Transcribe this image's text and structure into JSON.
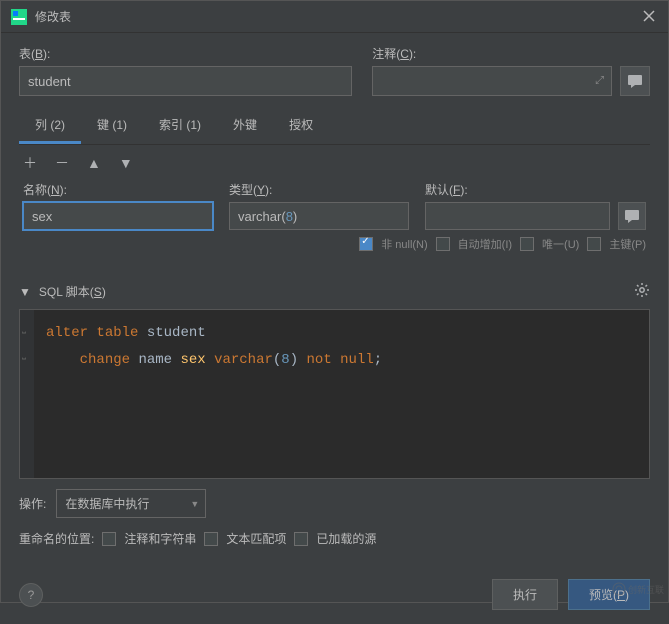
{
  "titlebar": {
    "title": "修改表"
  },
  "tableSection": {
    "tableLabelPrefix": "表(",
    "tableLabelKey": "B",
    "tableLabelSuffix": "):",
    "tableValue": "student",
    "commentLabelPrefix": "注释(",
    "commentLabelKey": "C",
    "commentLabelSuffix": "):",
    "commentValue": ""
  },
  "tabs": {
    "columns": "列 (2)",
    "keys": "键 (1)",
    "indexes": "索引 (1)",
    "foreign": "外键",
    "grants": "授权"
  },
  "fields": {
    "nameLabelPrefix": "名称(",
    "nameLabelKey": "N",
    "nameLabelSuffix": "):",
    "nameValue": "sex",
    "typeLabelPrefix": "类型(",
    "typeLabelKey": "Y",
    "typeLabelSuffix": "):",
    "typeTextPart": "varchar(",
    "typeNumPart": "8",
    "typeSuffix": ")",
    "defaultLabelPrefix": "默认(",
    "defaultLabelKey": "F",
    "defaultLabelSuffix": "):",
    "defaultValue": ""
  },
  "flags": {
    "notNull": "非 null(N)",
    "autoInc": "自动增加(I)",
    "unique": "唯一(U)",
    "primary": "主键(P)"
  },
  "sqlSection": {
    "labelPrefix": "SQL 脚本(",
    "labelKey": "S",
    "labelSuffix": ")"
  },
  "sql": {
    "alter": "alter",
    "table": "table",
    "student": "student",
    "change": "change",
    "name": "name",
    "sex": "sex",
    "varchar": "varchar",
    "lparen": "(",
    "eight": "8",
    "rparen": ")",
    "not": "not",
    "null": "null",
    "semi": ";"
  },
  "bottom": {
    "opLabel": "操作:",
    "opValue": "在数据库中执行",
    "renameLabel": "重命名的位置:",
    "cbComments": "注释和字符串",
    "cbText": "文本匹配项",
    "cbLoaded": "已加载的源"
  },
  "footer": {
    "help": "?",
    "execute": "执行",
    "previewPrefix": "预览(",
    "previewKey": "P",
    "previewSuffix": ")"
  },
  "watermark": "创新互联"
}
